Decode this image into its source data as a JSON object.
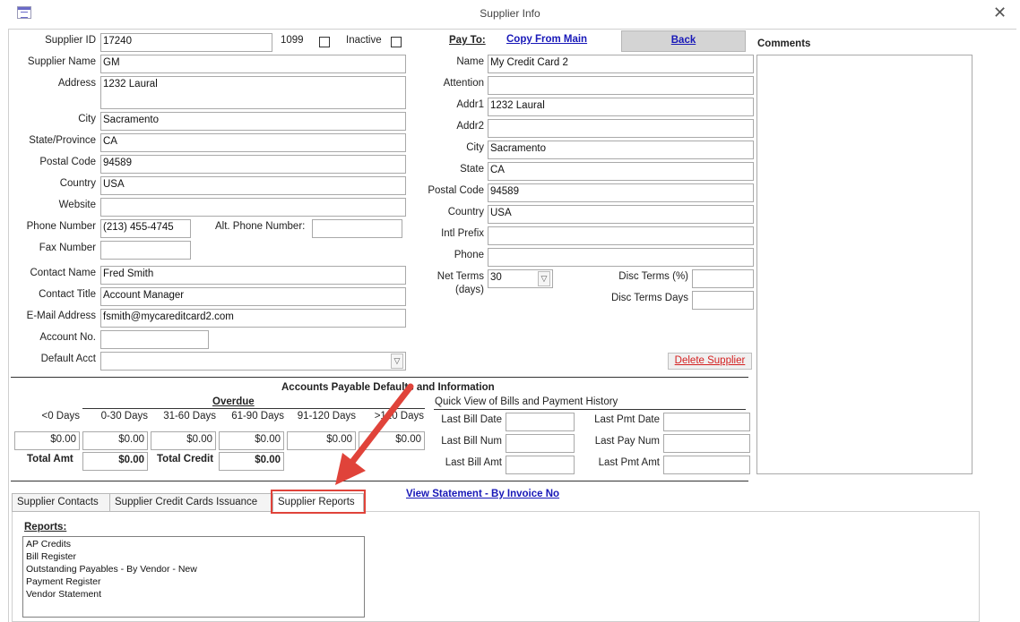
{
  "window": {
    "title": "Supplier Info"
  },
  "supplier": {
    "id_label": "Supplier ID",
    "id": "17240",
    "flag_1099_label": "1099",
    "inactive_label": "Inactive",
    "name_label": "Supplier Name",
    "name": "GM",
    "address_label": "Address",
    "address": "1232 Laural",
    "city_label": "City",
    "city": "Sacramento",
    "state_label": "State/Province",
    "state": "CA",
    "postal_label": "Postal Code",
    "postal": "94589",
    "country_label": "Country",
    "country": "USA",
    "website_label": "Website",
    "website": "",
    "phone_label": "Phone Number",
    "phone": "(213) 455-4745",
    "alt_phone_label": "Alt. Phone Number:",
    "alt_phone": "",
    "fax_label": "Fax Number",
    "fax": "",
    "contact_name_label": "Contact Name",
    "contact_name": "Fred Smith",
    "contact_title_label": "Contact Title",
    "contact_title": "Account Manager",
    "email_label": "E-Mail Address",
    "email": "fsmith@mycareditcard2.com",
    "account_no_label": "Account No.",
    "account_no": "",
    "default_acct_label": "Default Acct",
    "default_acct": ""
  },
  "payto": {
    "label": "Pay To:",
    "copy_link": "Copy From Main",
    "back_button": "Back",
    "name_label": "Name",
    "name": "My Credit Card 2",
    "attention_label": "Attention",
    "attention": "",
    "addr1_label": "Addr1",
    "addr1": "1232 Laural",
    "addr2_label": "Addr2",
    "addr2": "",
    "city_label": "City",
    "city": "Sacramento",
    "state_label": "State",
    "state": "CA",
    "postal_label": "Postal Code",
    "postal": "94589",
    "country_label": "Country",
    "country": "USA",
    "intl_prefix_label": "Intl Prefix",
    "intl_prefix": "",
    "phone_label": "Phone",
    "phone": "",
    "net_terms_label_1": "Net Terms",
    "net_terms_label_2": "(days)",
    "net_terms": "30",
    "disc_terms_label": "Disc Terms (%)",
    "disc_terms": "",
    "disc_days_label": "Disc Terms Days",
    "disc_days": "",
    "delete_button": "Delete Supplier"
  },
  "comments": {
    "label": "Comments",
    "value": ""
  },
  "ap": {
    "section_title": "Accounts Payable Defaults and Information",
    "overdue_label": "Overdue",
    "aging_headers": [
      "<0 Days",
      "0-30 Days",
      "31-60 Days",
      "61-90 Days",
      "91-120 Days",
      ">120 Days"
    ],
    "aging_values": [
      "$0.00",
      "$0.00",
      "$0.00",
      "$0.00",
      "$0.00",
      "$0.00"
    ],
    "total_amt_label": "Total Amt",
    "total_amt": "$0.00",
    "total_credit_label": "Total Credit",
    "total_credit": "$0.00",
    "quick_view_title": "Quick View of Bills and Payment History",
    "last_bill_date_label": "Last Bill Date",
    "last_bill_date": "",
    "last_bill_num_label": "Last Bill Num",
    "last_bill_num": "",
    "last_bill_amt_label": "Last Bill Amt",
    "last_bill_amt": "",
    "last_pmt_date_label": "Last Pmt Date",
    "last_pmt_date": "",
    "last_pay_num_label": "Last Pay Num",
    "last_pay_num": "",
    "last_pmt_amt_label": "Last Pmt Amt",
    "last_pmt_amt": ""
  },
  "statement_link": "View Statement - By Invoice No",
  "tabs": [
    {
      "label": "Supplier Contacts"
    },
    {
      "label": "Supplier Credit Cards Issuance"
    },
    {
      "label": "Supplier Reports"
    }
  ],
  "reports": {
    "label": "Reports:",
    "items": [
      "AP Credits",
      "Bill Register",
      "Outstanding Payables - By Vendor - New",
      "Payment Register",
      "Vendor Statement"
    ]
  },
  "colors": {
    "annotation": "#e0433a",
    "link": "#1818b8",
    "delete": "#d42020"
  }
}
